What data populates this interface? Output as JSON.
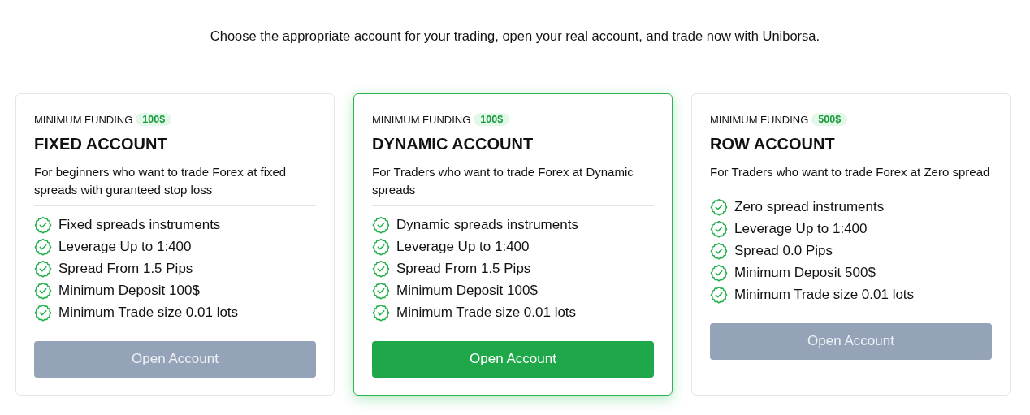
{
  "intro": "Choose the appropriate account for your trading, open your real account, and trade now with Uniborsa.",
  "plans": [
    {
      "funding_label": "MINIMUM FUNDING",
      "funding_amount": "100$",
      "title": "FIXED ACCOUNT",
      "description": "For beginners who want to trade Forex at fixed spreads with guranteed stop loss",
      "features": [
        "Fixed spreads instruments",
        "Leverage Up to 1:400",
        "Spread From 1.5 Pips",
        "Minimum Deposit 100$",
        "Minimum Trade size 0.01 lots"
      ],
      "button": "Open Account",
      "selected": false
    },
    {
      "funding_label": "MINIMUM FUNDING",
      "funding_amount": "100$",
      "title": "DYNAMIC ACCOUNT",
      "description": "For Traders who want to trade Forex at Dynamic spreads",
      "features": [
        "Dynamic spreads instruments",
        "Leverage Up to 1:400",
        "Spread From 1.5 Pips",
        "Minimum Deposit 100$",
        "Minimum Trade size 0.01 lots"
      ],
      "button": "Open Account",
      "selected": true
    },
    {
      "funding_label": "MINIMUM FUNDING",
      "funding_amount": "500$",
      "title": "ROW ACCOUNT",
      "description": "For Traders who want to trade Forex at Zero spread",
      "features": [
        "Zero spread instruments",
        "Leverage Up to 1:400",
        "Spread 0.0 Pips",
        "Minimum Deposit 500$",
        "Minimum Trade size 0.01 lots"
      ],
      "button": "Open Account",
      "selected": false
    }
  ]
}
